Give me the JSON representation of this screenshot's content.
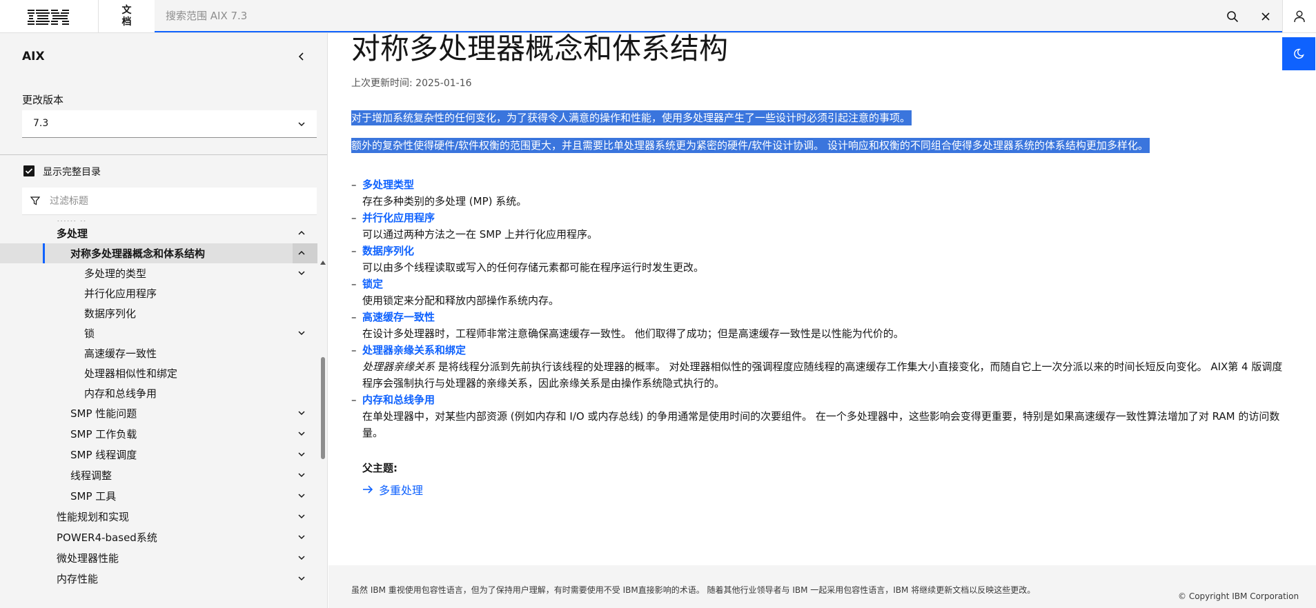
{
  "header": {
    "logo_text": "IBM",
    "docs_label": "文档",
    "search_placeholder": "搜索范围 AIX 7.3"
  },
  "sidebar": {
    "title": "AIX",
    "version_label": "更改版本",
    "version_value": "7.3",
    "show_full_toc": "显示完整目录",
    "filter_placeholder": "过滤标题",
    "items": [
      {
        "label": "多处理"
      },
      {
        "label": "对称多处理器概念和体系结构"
      },
      {
        "label": "多处理的类型"
      },
      {
        "label": "并行化应用程序"
      },
      {
        "label": "数据序列化"
      },
      {
        "label": "锁"
      },
      {
        "label": "高速缓存一致性"
      },
      {
        "label": "处理器相似性和绑定"
      },
      {
        "label": "内存和总线争用"
      },
      {
        "label": "SMP 性能问题"
      },
      {
        "label": "SMP 工作负载"
      },
      {
        "label": "SMP 线程调度"
      },
      {
        "label": "线程调整"
      },
      {
        "label": "SMP 工具"
      },
      {
        "label": "性能规划和实现"
      },
      {
        "label": "POWER4-based系统"
      },
      {
        "label": "微处理器性能"
      },
      {
        "label": "内存性能"
      }
    ]
  },
  "main": {
    "title": "对称多处理器概念和体系结构",
    "updated": "上次更新时间: 2025-01-16",
    "highlight1": "对于增加系统复杂性的任何变化，为了获得令人满意的操作和性能，使用多处理器产生了一些设计时必须引起注意的事项。",
    "highlight2": "额外的复杂性使得硬件/软件权衡的范围更大，并且需要比单处理器系统更为紧密的硬件/软件设计协调。 设计响应和权衡的不同组合使得多处理器系统的体系结构更加多样化。",
    "topics": [
      {
        "term": "多处理类型",
        "desc": "存在多种类别的多处理 (MP) 系统。"
      },
      {
        "term": "并行化应用程序",
        "desc": "可以通过两种方法之一在 SMP 上并行化应用程序。"
      },
      {
        "term": "数据序列化",
        "desc": "可以由多个线程读取或写入的任何存储元素都可能在程序运行时发生更改。"
      },
      {
        "term": "锁定",
        "desc": "使用锁定来分配和释放内部操作系统内存。"
      },
      {
        "term": "高速缓存一致性",
        "desc": "在设计多处理器时，工程师非常注意确保高速缓存一致性。 他们取得了成功；但是高速缓存一致性是以性能为代价的。"
      },
      {
        "term": "处理器亲缘关系和绑定",
        "desc_em": "处理器亲缘关系",
        "desc": " 是将线程分派到先前执行该线程的处理器的概率。 对处理器相似性的强调程度应随线程的高速缓存工作集大小直接变化，而随自它上一次分派以来的时间长短反向变化。 AIX第 4 版调度程序会强制执行与处理器的亲缘关系，因此亲缘关系是由操作系统隐式执行的。"
      },
      {
        "term": "内存和总线争用",
        "desc": "在单处理器中，对某些内部资源 (例如内存和 I/O 或内存总线) 的争用通常是使用时间的次要组件。 在一个多处理器中，这些影响会变得更重要，特别是如果高速缓存一致性算法增加了对 RAM 的访问数量。"
      }
    ],
    "parent_label": "父主题:",
    "parent_link": "多重处理"
  },
  "footer": {
    "text": "虽然 IBM 重视使用包容性语言，但为了保持用户理解，有时需要使用不受 IBM直接影响的术语。 随着其他行业领导者与 IBM 一起采用包容性语言，IBM 将继续更新文档以反映这些更改。",
    "copyright": "© Copyright IBM Corporation"
  }
}
